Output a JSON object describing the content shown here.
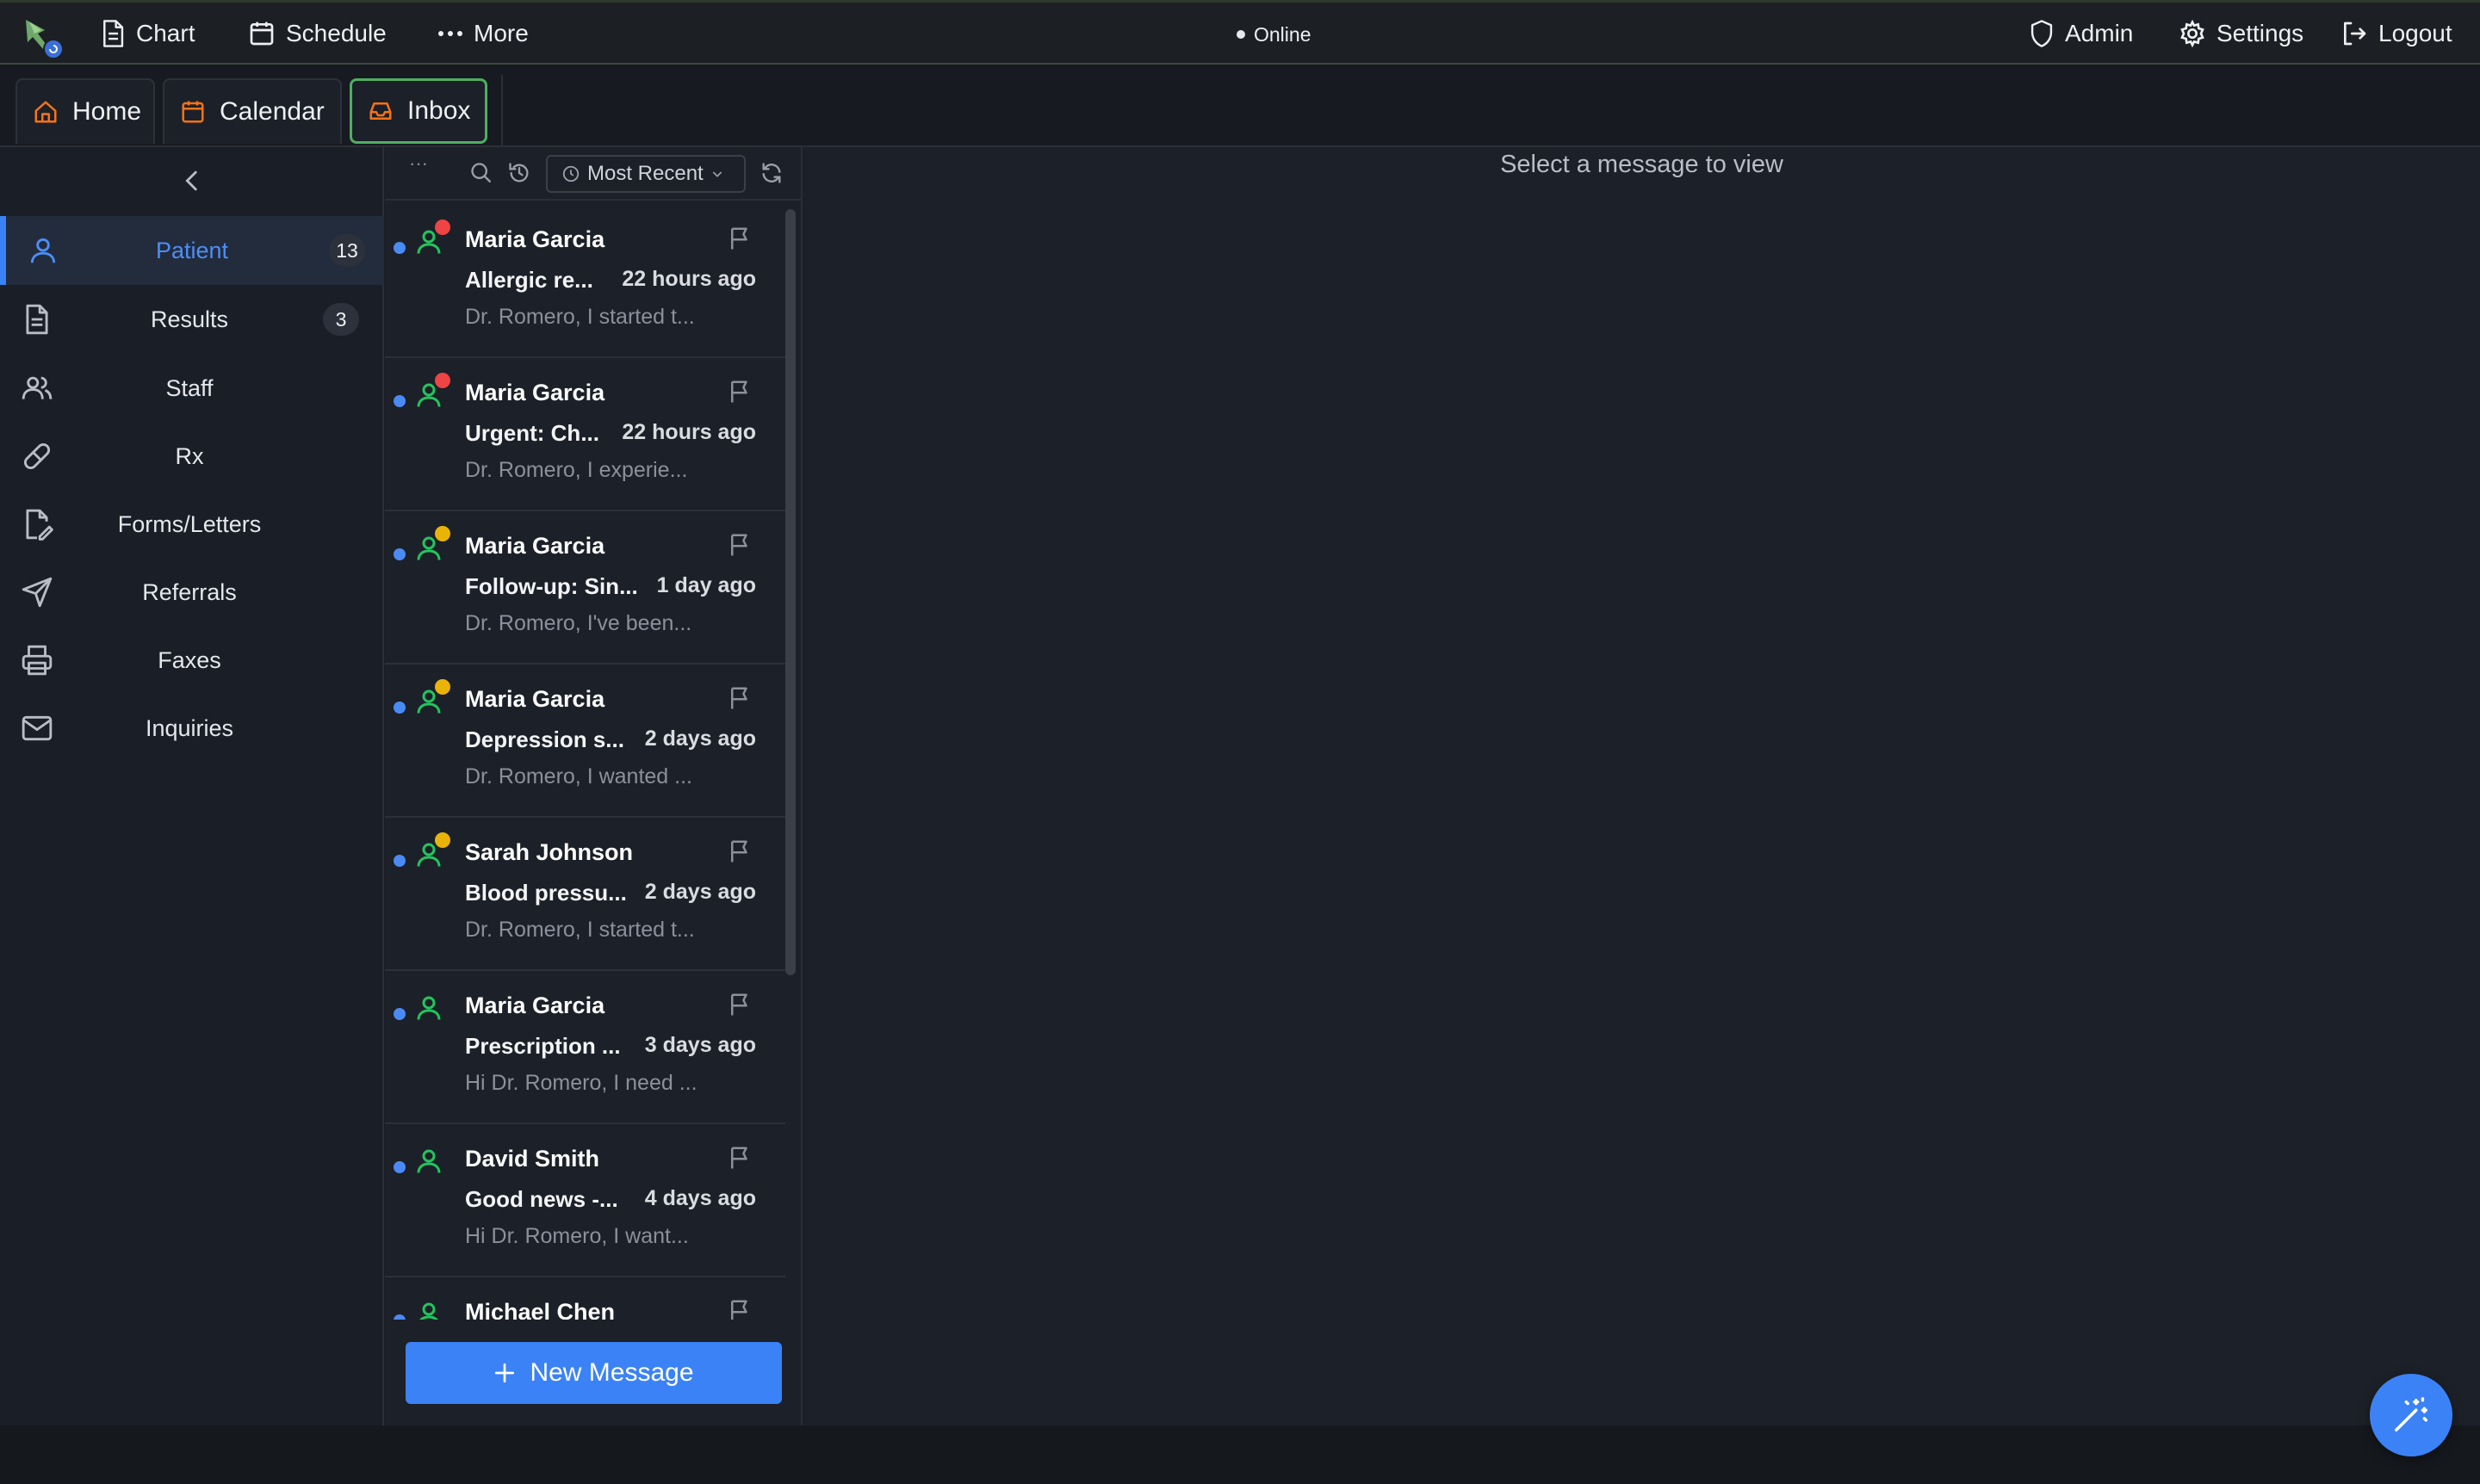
{
  "topnav": {
    "chart_label": "Chart",
    "schedule_label": "Schedule",
    "more_label": "More",
    "status_label": "Online",
    "admin_label": "Admin",
    "settings_label": "Settings",
    "logout_label": "Logout"
  },
  "tabs": [
    {
      "label": "Home",
      "icon": "home-icon"
    },
    {
      "label": "Calendar",
      "icon": "calendar-icon"
    },
    {
      "label": "Inbox",
      "icon": "inbox-icon",
      "active": true
    }
  ],
  "sidebar": {
    "items": [
      {
        "label": "Patient",
        "icon": "user-icon",
        "count": "13",
        "active": true
      },
      {
        "label": "Results",
        "icon": "document-icon",
        "count": "3"
      },
      {
        "label": "Staff",
        "icon": "users-icon"
      },
      {
        "label": "Rx",
        "icon": "pill-icon"
      },
      {
        "label": "Forms/Letters",
        "icon": "edit-document-icon"
      },
      {
        "label": "Referrals",
        "icon": "send-icon"
      },
      {
        "label": "Faxes",
        "icon": "printer-icon"
      },
      {
        "label": "Inquiries",
        "icon": "mail-icon"
      }
    ]
  },
  "toolbar": {
    "more_label": "···",
    "sort_label": "Most Recent"
  },
  "messages": [
    {
      "from": "Maria Garcia",
      "subject": "Allergic re...",
      "time": "22 hours ago",
      "preview": "Dr. Romero, I started t...",
      "priority_color": "#ef4444"
    },
    {
      "from": "Maria Garcia",
      "subject": "Urgent: Ch...",
      "time": "22 hours ago",
      "preview": "Dr. Romero, I experie...",
      "priority_color": "#ef4444"
    },
    {
      "from": "Maria Garcia",
      "subject": "Follow-up: Sin...",
      "time": "1 day ago",
      "preview": "Dr. Romero, I've been...",
      "priority_color": "#eab308"
    },
    {
      "from": "Maria Garcia",
      "subject": "Depression s...",
      "time": "2 days ago",
      "preview": "Dr. Romero, I wanted ...",
      "priority_color": "#eab308"
    },
    {
      "from": "Sarah Johnson",
      "subject": "Blood pressu...",
      "time": "2 days ago",
      "preview": "Dr. Romero, I started t...",
      "priority_color": "#eab308"
    },
    {
      "from": "Maria Garcia",
      "subject": "Prescription ...",
      "time": "3 days ago",
      "preview": "Hi Dr. Romero, I need ...",
      "priority_color": ""
    },
    {
      "from": "David Smith",
      "subject": "Good news -...",
      "time": "4 days ago",
      "preview": "Hi Dr. Romero, I want...",
      "priority_color": ""
    },
    {
      "from": "Michael Chen",
      "subject": "",
      "time": "",
      "preview": "",
      "priority_color": ""
    }
  ],
  "new_message_label": "New Message",
  "viewer": {
    "placeholder": "Select a message to view"
  },
  "colors": {
    "accent": "#3b82f6",
    "active_tab_border": "#4fae62",
    "person_icon": "#22c55e",
    "tab_icon": "#f97316",
    "unread_dot": "#4a8af4"
  }
}
